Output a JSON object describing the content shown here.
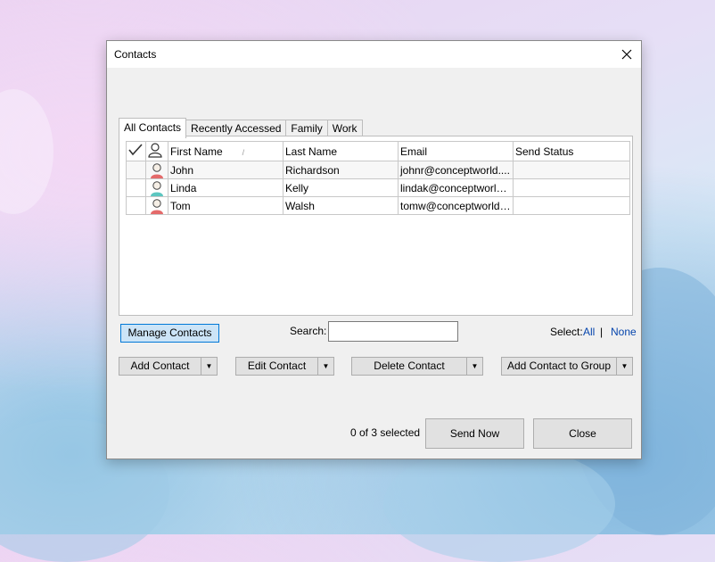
{
  "dialog": {
    "title": "Contacts"
  },
  "tabs": [
    {
      "label": "All Contacts",
      "active": true
    },
    {
      "label": "Recently Accessed",
      "active": false
    },
    {
      "label": "Family",
      "active": false
    },
    {
      "label": "Work",
      "active": false
    }
  ],
  "table": {
    "columns": [
      "First Name",
      "Last Name",
      "Email",
      "Send Status"
    ],
    "sort_indicator": "/",
    "rows": [
      {
        "first": "John",
        "last": "Richardson",
        "email": "johnr@conceptworld....",
        "status": "",
        "avatar_color": "#e46a6a",
        "selected_focus": true
      },
      {
        "first": "Linda",
        "last": "Kelly",
        "email": "lindak@conceptworld...",
        "status": "",
        "avatar_color": "#5cc6c0",
        "selected_focus": false
      },
      {
        "first": "Tom",
        "last": "Walsh",
        "email": "tomw@conceptworld....",
        "status": "",
        "avatar_color": "#e46a6a",
        "selected_focus": false
      }
    ]
  },
  "controls": {
    "manage_contacts": "Manage Contacts",
    "search_label": "Search:",
    "search_value": "",
    "select_label": "Select:",
    "select_all": "All",
    "select_sep": "|",
    "select_none": "None"
  },
  "actions": {
    "add_contact": "Add Contact",
    "edit_contact": "Edit Contact",
    "delete_contact": "Delete Contact",
    "add_to_group": "Add Contact to Group"
  },
  "footer": {
    "selection_status": "0 of 3 selected",
    "send_now": "Send Now",
    "close": "Close"
  },
  "colors": {
    "accent_button": "#cce4f7",
    "accent_border": "#0078d7",
    "link": "#0645ad"
  }
}
